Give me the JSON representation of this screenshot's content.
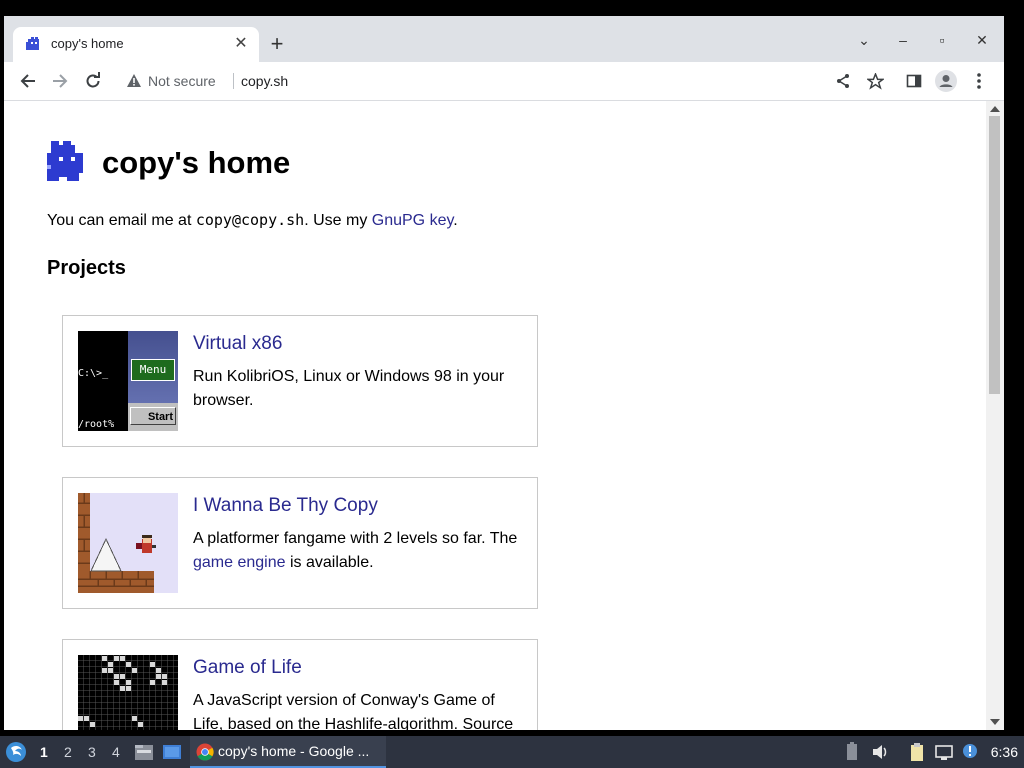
{
  "browser": {
    "tab_title": "copy's home",
    "new_tab_label": "+",
    "security_label": "Not secure",
    "url": "copy.sh"
  },
  "page": {
    "heading": "copy's home",
    "email_prefix": "You can email me at ",
    "email_address": "copy@copy.sh",
    "email_mid": ". Use my ",
    "gpg_link": "GnuPG key",
    "email_suffix": ".",
    "projects_title": "Projects",
    "projects": [
      {
        "title": "Virtual x86",
        "desc": "Run KolibriOS, Linux or Windows 98 in your browser.",
        "thumb": {
          "prompt": "C:\\>_",
          "root": "/root%",
          "menu": "Menu",
          "start": "Start"
        }
      },
      {
        "title": "I Wanna Be Thy Copy",
        "desc_prefix": "A platformer fangame with 2 levels so far. The ",
        "desc_link": "game engine",
        "desc_suffix": " is available."
      },
      {
        "title": "Game of Life",
        "desc": "A JavaScript version of Conway's Game of Life, based on the Hashlife-algorithm. Source"
      }
    ]
  },
  "taskbar": {
    "workspaces": [
      "1",
      "2",
      "3",
      "4"
    ],
    "active_workspace": "1",
    "task_label": "copy's home - Google ...",
    "clock": "6:36"
  },
  "colors": {
    "link": "#2a2a8f",
    "logo": "#2d3bd0",
    "taskbar_bg": "#2d3340"
  }
}
